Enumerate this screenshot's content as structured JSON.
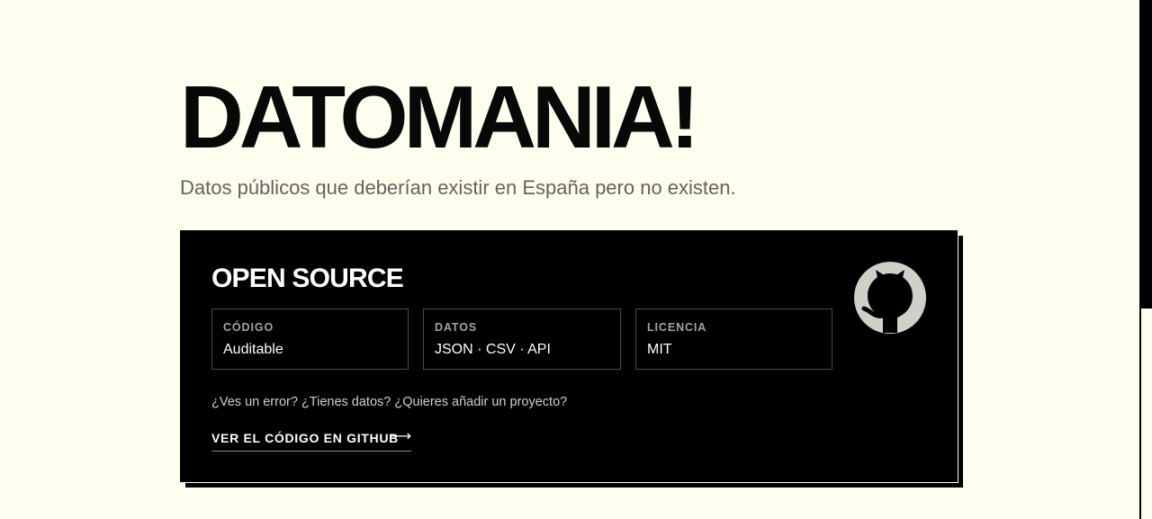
{
  "hero": {
    "title": "DATOMANIA!",
    "subtitle": "Datos públicos que deberían existir en España pero no existen."
  },
  "open_source": {
    "title": "OPEN SOURCE",
    "boxes": [
      {
        "label": "CÓDIGO",
        "value": "Auditable"
      },
      {
        "label": "DATOS",
        "value": "JSON · CSV · API"
      },
      {
        "label": "LICENCIA",
        "value": "MIT"
      }
    ],
    "question": "¿Ves un error? ¿Tienes datos? ¿Quieres añadir un proyecto?",
    "link_label": "VER EL CÓDIGO EN GITHUB",
    "link_arrow": "⟶",
    "logo_icon": "github-icon"
  },
  "colors": {
    "background": "#fffff0",
    "card": "#000000",
    "subtitle_text": "#65625d",
    "box_border": "#4a4a4a",
    "logo": "#d0d0c8"
  }
}
